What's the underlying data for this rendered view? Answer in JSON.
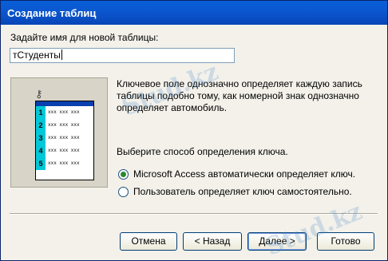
{
  "window": {
    "title": "Создание таблиц"
  },
  "form": {
    "name_label": "Задайте имя для новой таблицы:",
    "name_value": "тСтуденты"
  },
  "illustration": {
    "rows": [
      "1",
      "2",
      "3",
      "4",
      "5"
    ],
    "cell_text": "ххх ххх ххх"
  },
  "description": "Ключевое поле однозначно определяет каждую запись таблицы подобно тому, как номерной знак однозначно определяет автомобиль.",
  "choose_label": "Выберите способ определения ключа.",
  "options": [
    {
      "label": "Microsoft Access автоматически определяет ключ.",
      "selected": true
    },
    {
      "label": "Пользователь определяет ключ самостоятельно.",
      "selected": false
    }
  ],
  "buttons": {
    "cancel": "Отмена",
    "back": "< Назад",
    "next": "Далее >",
    "finish": "Готово"
  },
  "watermark": "Stud.kz"
}
